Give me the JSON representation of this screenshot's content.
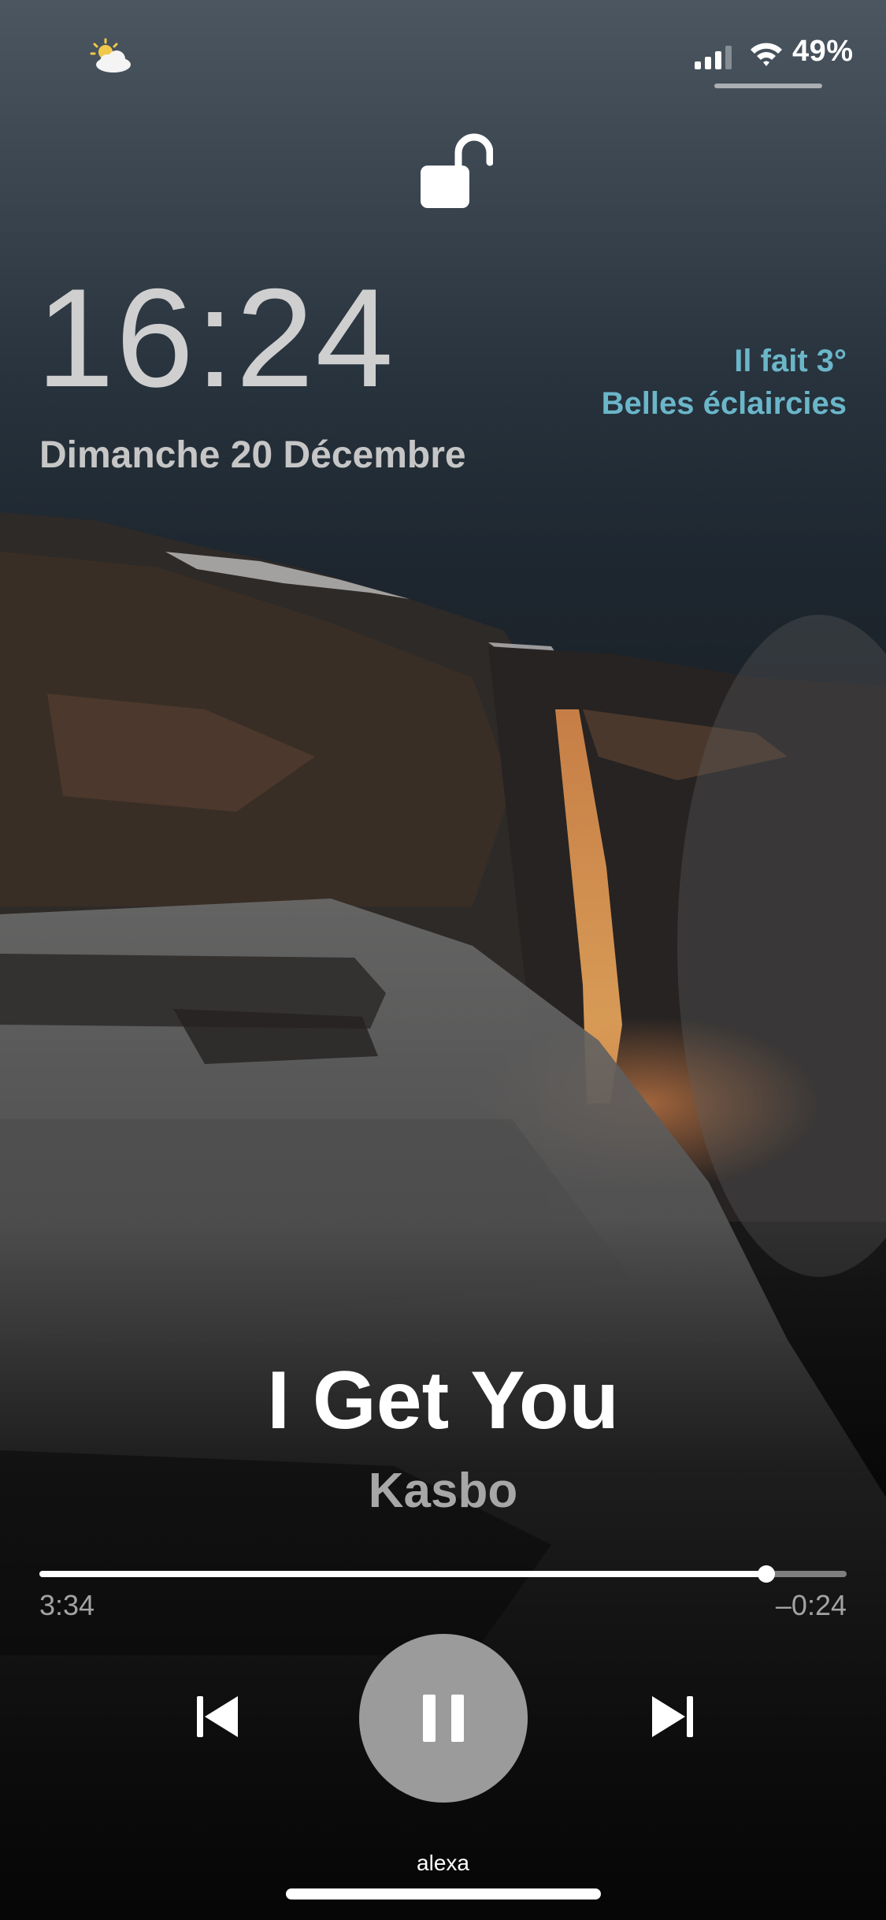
{
  "status_bar": {
    "weather_icon": "partly-cloudy-icon",
    "signal_icon": "cellular-signal-icon",
    "wifi_icon": "wifi-icon",
    "battery_percent": "49%"
  },
  "lock": {
    "icon": "unlocked-padlock-icon"
  },
  "clock": {
    "time": "16:24",
    "date": "Dimanche 20 Décembre"
  },
  "weather_widget": {
    "line1": "Il fait 3°",
    "line2": "Belles éclaircies",
    "color": "#6bb6c9"
  },
  "now_playing": {
    "title": "I Get You",
    "artist": "Kasbo",
    "elapsed": "3:34",
    "remaining": "–0:24",
    "progress_fraction": 0.9
  },
  "controls": {
    "previous_icon": "skip-previous-icon",
    "pause_icon": "pause-icon",
    "next_icon": "skip-next-icon"
  },
  "footer": {
    "label": "alexa"
  }
}
